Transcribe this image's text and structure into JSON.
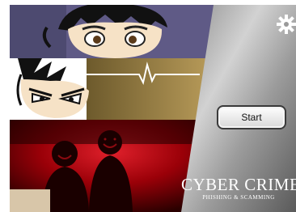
{
  "menu": {
    "start_label": "Start",
    "settings_icon": "gear-icon"
  },
  "branding": {
    "title": "CYBER CRIME",
    "subtitle": "PHISHING & SCAMMING"
  },
  "colors": {
    "panel_top": "#5f5a86",
    "panel_middle": "#8a743e",
    "panel_bottom": "#b0000b",
    "metal": "#a8a8a8"
  }
}
